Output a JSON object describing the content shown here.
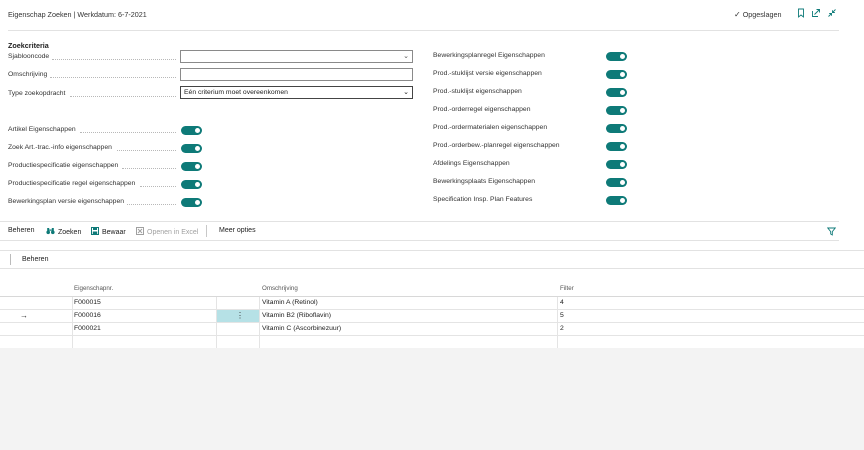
{
  "header": {
    "title": "Eigenschap Zoeken | Werkdatum: 6-7-2021",
    "saved": "Opgeslagen"
  },
  "criteria": {
    "title": "Zoekcriteria",
    "fields": [
      {
        "label": "Sjablooncode",
        "value": ""
      },
      {
        "label": "Omschrijving",
        "value": ""
      },
      {
        "label": "Type zoekopdracht",
        "value": "Eén criterium moet overeenkomen"
      }
    ],
    "left_toggles": [
      {
        "label": "Artikel Eigenschappen",
        "on": true
      },
      {
        "label": "Zoek Art.-trac.-info eigenschappen",
        "on": true
      },
      {
        "label": "Productiespecificatie eigenschappen",
        "on": true
      },
      {
        "label": "Productiespecificatie regel eigenschappen",
        "on": true
      },
      {
        "label": "Bewerkingsplan versie eigenschappen",
        "on": true
      }
    ],
    "right_toggles": [
      {
        "label": "Bewerkingsplanregel Eigenschappen",
        "on": true
      },
      {
        "label": "Prod.-stuklijst versie eigenschappen",
        "on": true
      },
      {
        "label": "Prod.-stuklijst eigenschappen",
        "on": true
      },
      {
        "label": "Prod.-orderregel eigenschappen",
        "on": true
      },
      {
        "label": "Prod.-ordermaterialen eigenschappen",
        "on": true
      },
      {
        "label": "Prod.-orderbew.-planregel eigenschappen",
        "on": true
      },
      {
        "label": "Afdelings Eigenschappen",
        "on": true
      },
      {
        "label": "Bewerkingsplaats Eigenschappen",
        "on": true
      },
      {
        "label": "Specification Insp. Plan Features",
        "on": true
      }
    ]
  },
  "actions": {
    "beheren": "Beheren",
    "zoeken": "Zoeken",
    "bewaar": "Bewaar",
    "excel": "Openen in Excel",
    "meer": "Meer opties"
  },
  "sub_actions": {
    "beheren": "Beheren"
  },
  "table": {
    "columns": [
      "Eigenschapnr.",
      "Omschrijving",
      "Filter"
    ],
    "rows": [
      {
        "nr": "F000015",
        "desc": "Vitamin A (Retinol)",
        "filter": "4",
        "selected": false
      },
      {
        "nr": "F000016",
        "desc": "Vitamin B2 (Riboflavin)",
        "filter": "5",
        "selected": true
      },
      {
        "nr": "F000021",
        "desc": "Vitamin C (Ascorbinezuur)",
        "filter": "2",
        "selected": false
      },
      {
        "nr": "",
        "desc": "",
        "filter": "",
        "selected": false
      }
    ]
  },
  "colors": {
    "accent": "#0e7a78",
    "selected_cell": "#b6e1e6"
  },
  "icons": [
    "checkmark-icon",
    "bookmark-icon",
    "open-new-window-icon",
    "collapse-icon",
    "binoculars-icon",
    "save-icon",
    "excel-icon",
    "filter-icon",
    "row-arrow-icon",
    "row-menu-icon",
    "dropdown-chevron-icon"
  ]
}
